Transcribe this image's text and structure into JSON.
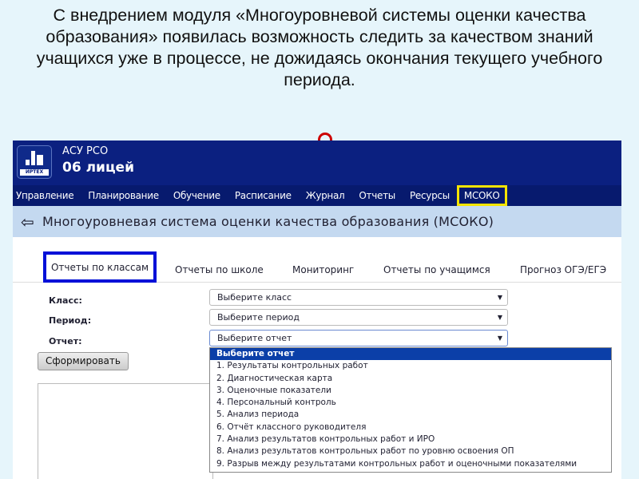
{
  "caption": "С внедрением модуля «Многоуровневой системы оценки качества образования» появилась возможность следить за качеством знаний учащихся уже в процессе, не дожидаясь окончания текущего учебного периода.",
  "header": {
    "logo_text": "ИРТЕХ",
    "app": "АСУ РСО",
    "school": "06 лицей"
  },
  "nav": [
    "Управление",
    "Планирование",
    "Обучение",
    "Расписание",
    "Журнал",
    "Отчеты",
    "Ресурсы",
    "МСОКО"
  ],
  "page_title": "Многоуровневая система оценки качества образования (МСОКО)",
  "tabs": [
    "Отчеты по классам",
    "Отчеты по школе",
    "Мониторинг",
    "Отчеты по учащимся",
    "Прогноз ОГЭ/ЕГЭ"
  ],
  "form": {
    "class_label": "Класс:",
    "class_value": "Выберите класс",
    "period_label": "Период:",
    "period_value": "Выберите период",
    "report_label": "Отчет:",
    "report_value": "Выберите отчет",
    "submit": "Сформировать"
  },
  "report_options": [
    "Выберите отчет",
    "1. Результаты контрольных работ",
    "2. Диагностическая карта",
    "3. Оценочные показатели",
    "4. Персональный контроль",
    "5. Анализ периода",
    "6. Отчёт классного руководителя",
    "7. Анализ результатов контрольных работ и ИРО",
    "8. Анализ результатов контрольных работ по уровню освоения ОП",
    "9. Разрыв между результатами контрольных работ и оценочными показателями"
  ],
  "colors": {
    "header": "#0b2080",
    "highlight_yellow": "#f5e400",
    "highlight_blue": "#0010d8"
  }
}
